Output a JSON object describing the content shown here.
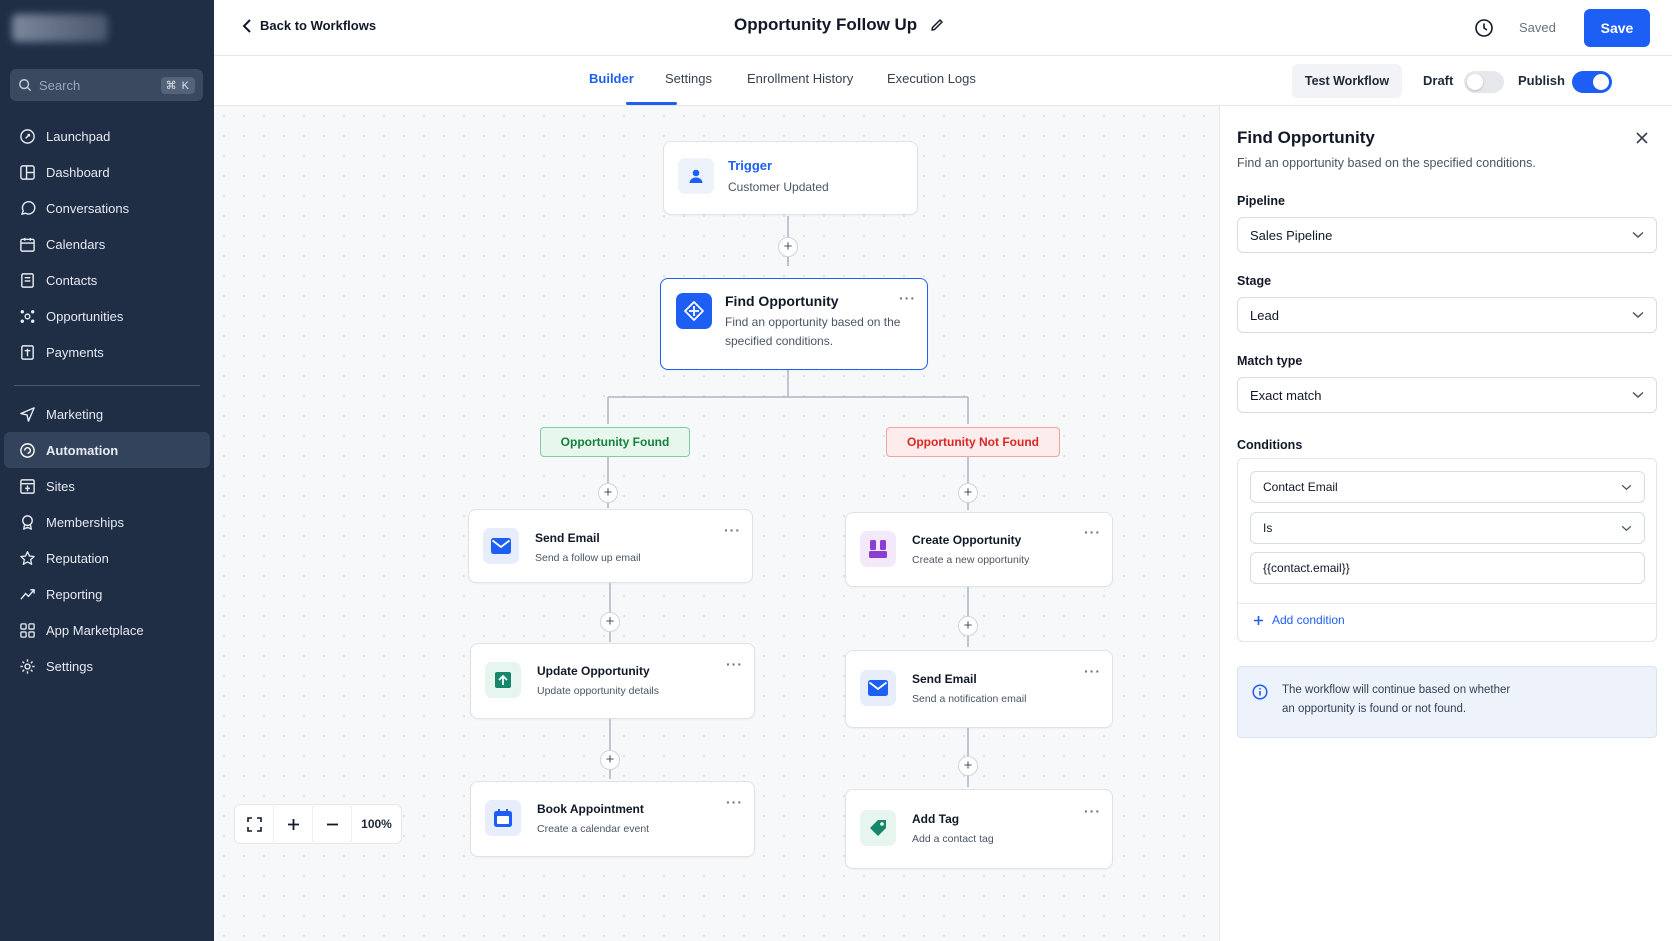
{
  "sidebar": {
    "search": {
      "placeholder": "Search",
      "shortcut": "⌘ K"
    },
    "items_top": [
      {
        "label": "Launchpad",
        "icon": "rocket-icon"
      },
      {
        "label": "Dashboard",
        "icon": "dashboard-icon"
      },
      {
        "label": "Conversations",
        "icon": "chat-icon"
      },
      {
        "label": "Calendars",
        "icon": "calendar-icon"
      },
      {
        "label": "Contacts",
        "icon": "contacts-icon"
      },
      {
        "label": "Opportunities",
        "icon": "opportunities-icon"
      },
      {
        "label": "Payments",
        "icon": "payments-icon"
      }
    ],
    "items_bottom": [
      {
        "label": "Marketing",
        "icon": "send-icon"
      },
      {
        "label": "Automation",
        "icon": "automation-icon",
        "active": true
      },
      {
        "label": "Sites",
        "icon": "sites-icon"
      },
      {
        "label": "Memberships",
        "icon": "membership-icon"
      },
      {
        "label": "Reputation",
        "icon": "star-icon"
      },
      {
        "label": "Reporting",
        "icon": "trend-icon"
      },
      {
        "label": "App Marketplace",
        "icon": "grid-icon"
      },
      {
        "label": "Settings",
        "icon": "gear-icon"
      }
    ]
  },
  "header": {
    "back_label": "Back to Workflows",
    "title": "Opportunity Follow Up",
    "saved_label": "Saved",
    "save_label": "Save"
  },
  "tabs": [
    {
      "label": "Builder",
      "active": true
    },
    {
      "label": "Settings"
    },
    {
      "label": "Enrollment History"
    },
    {
      "label": "Execution Logs"
    }
  ],
  "toolbar": {
    "test_label": "Test Workflow",
    "draft_label": "Draft",
    "draft_on": false,
    "publish_label": "Publish",
    "publish_on": true
  },
  "canvas": {
    "trigger": {
      "title": "Trigger",
      "subtitle": "Customer Updated"
    },
    "find": {
      "title": "Find Opportunity",
      "subtitle": "Find an opportunity based on the specified conditions."
    },
    "branch_found": "Opportunity Found",
    "branch_not_found": "Opportunity Not Found",
    "left_nodes": [
      {
        "title": "Send Email",
        "subtitle": "Send a follow up email",
        "icon": "mail-icon"
      },
      {
        "title": "Update Opportunity",
        "subtitle": "Update opportunity details",
        "icon": "update-icon"
      },
      {
        "title": "Book Appointment",
        "subtitle": "Create a calendar event",
        "icon": "calendar-icon"
      }
    ],
    "right_nodes": [
      {
        "title": "Create Opportunity",
        "subtitle": "Create a new opportunity",
        "icon": "create-icon"
      },
      {
        "title": "Send Email",
        "subtitle": "Send a notification email",
        "icon": "mail-icon"
      },
      {
        "title": "Add Tag",
        "subtitle": "Add a contact tag",
        "icon": "tag-icon"
      }
    ],
    "menu_glyph": "···",
    "zoom": "100%"
  },
  "panel": {
    "title": "Find Opportunity",
    "description": "Find an opportunity based on the specified conditions.",
    "pipeline_label": "Pipeline",
    "pipeline_value": "Sales Pipeline",
    "stage_label": "Stage",
    "stage_value": "Lead",
    "match_label": "Match type",
    "match_value": "Exact match",
    "conditions_label": "Conditions",
    "condition_field": "Contact Email",
    "condition_operator": "Is",
    "condition_value": "{{contact.email}}",
    "add_condition": "Add condition",
    "info_line1": "The workflow will continue based on whether",
    "info_line2": "an opportunity is found or not found."
  },
  "colors": {
    "accent": "#1d5ff5",
    "sidebar": "#1f2d45",
    "found": "#16a34a",
    "not_found": "#dc2626"
  }
}
